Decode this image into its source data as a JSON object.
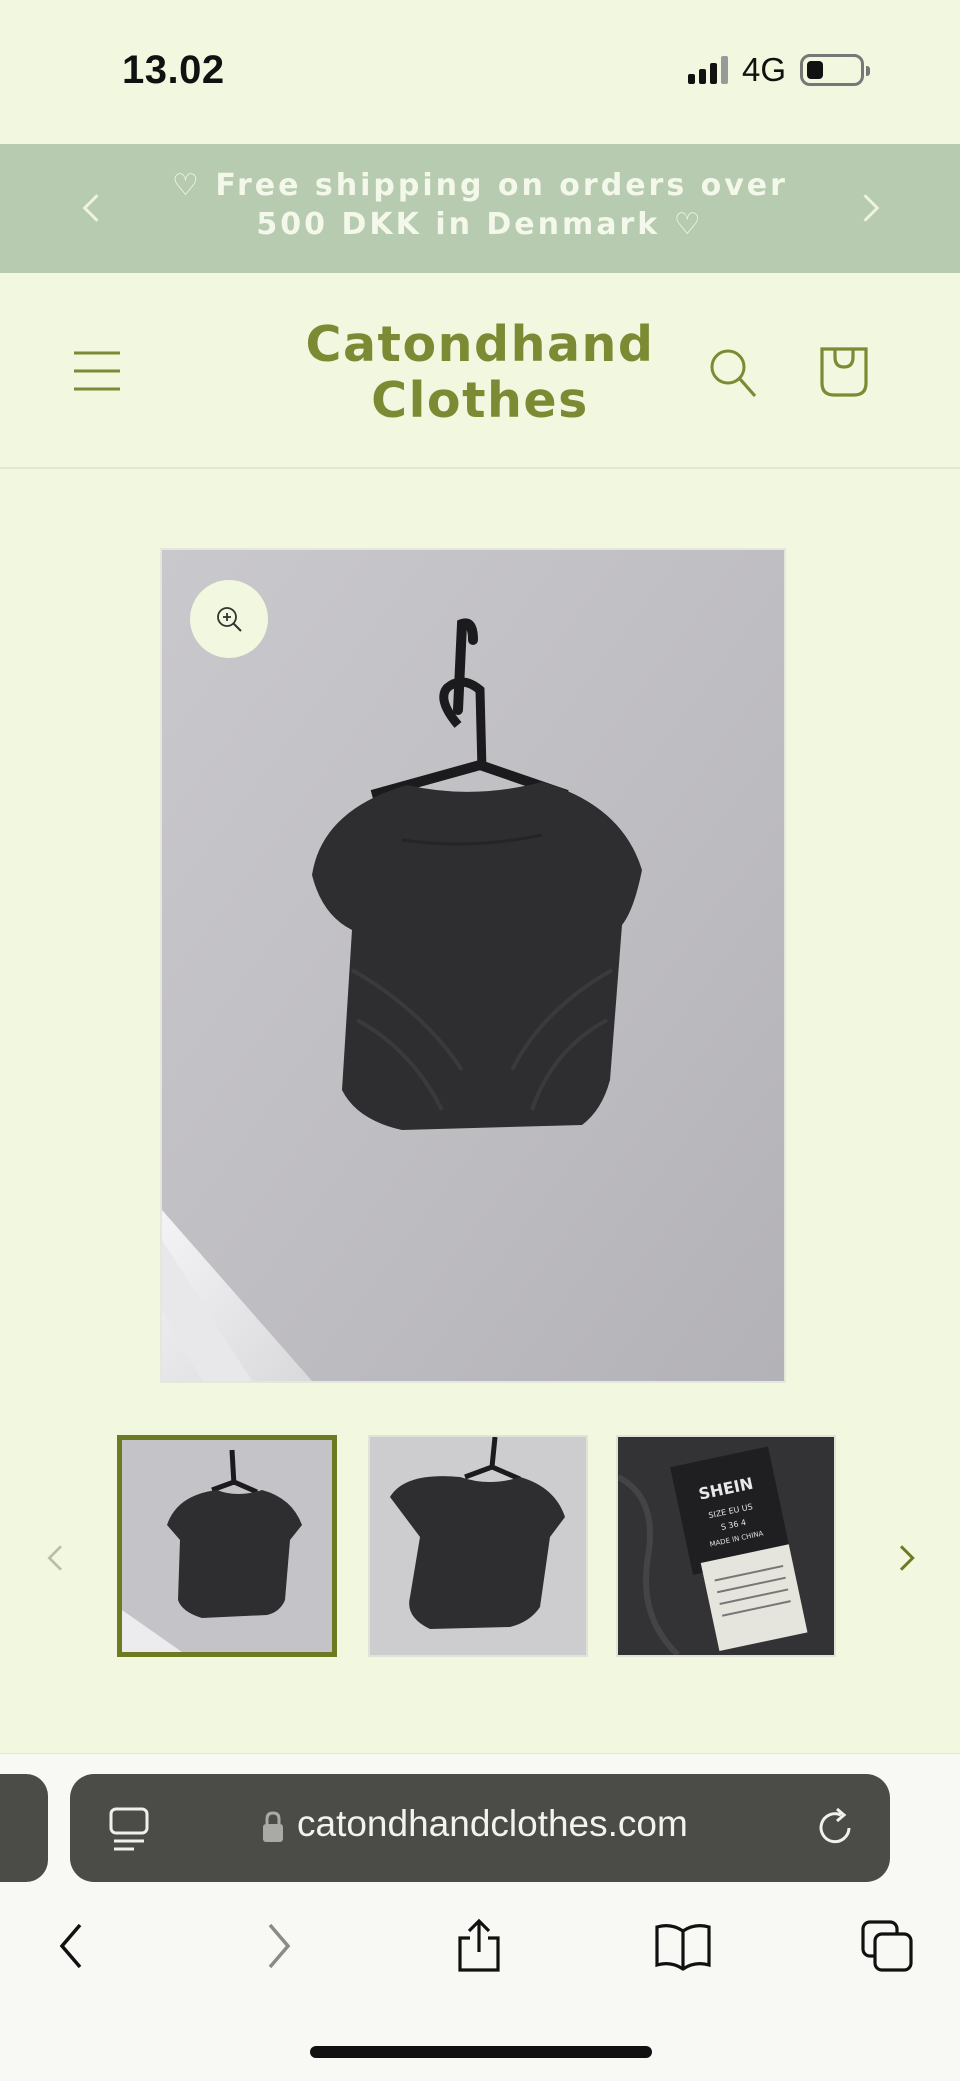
{
  "status_bar": {
    "time": "13.02",
    "network": "4G"
  },
  "announcement": {
    "text": "♡ Free shipping on orders over 500 DKK in Denmark ♡"
  },
  "header": {
    "logo_line1": "Catondhand",
    "logo_line2": "Clothes"
  },
  "product": {
    "thumbnails": [
      {
        "label": "SHEIN",
        "tag_line1": "SIZE EU US",
        "tag_line2": "S  36  4",
        "tag_line3": "MADE IN CHINA"
      }
    ]
  },
  "browser": {
    "url": "catondhandclothes.com"
  },
  "colors": {
    "background": "#f2f7df",
    "announcement_bg": "#b6cbb0",
    "brand_olive": "#7b8a33",
    "active_thumb_border": "#6e7a22",
    "browser_bar": "#4b4c47"
  }
}
